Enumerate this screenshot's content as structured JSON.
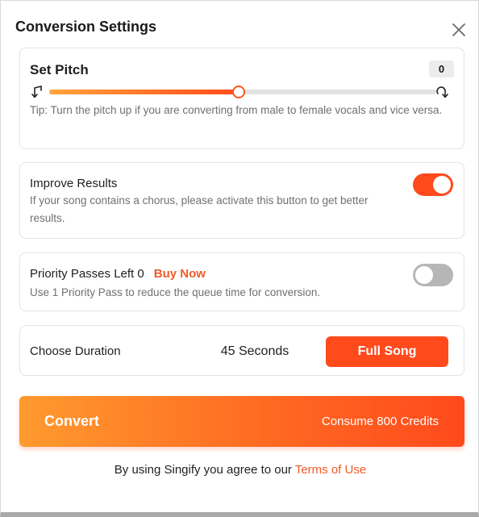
{
  "dialog": {
    "title": "Conversion Settings",
    "close_icon": "close-icon"
  },
  "pitch": {
    "label": "Set Pitch",
    "value": "0",
    "slider_fraction": 0.49,
    "left_icon": "pitch-down-icon",
    "right_icon": "pitch-up-icon",
    "tip": "Tip: Turn the pitch up if you are converting from male to female vocals and vice versa."
  },
  "improve": {
    "label": "Improve Results",
    "description": "If your song contains a chorus, please activate this button to get better results.",
    "enabled": true
  },
  "priority": {
    "label": "Priority Passes Left 0",
    "buy_label": "Buy Now",
    "description": "Use 1 Priority Pass to reduce the queue time for conversion.",
    "enabled": false
  },
  "duration": {
    "label": "Choose Duration",
    "options": [
      "45 Seconds",
      "Full Song"
    ],
    "selected": "Full Song"
  },
  "convert": {
    "label": "Convert",
    "credits": "Consume 800 Credits"
  },
  "footer": {
    "text": "By using Singify you agree to our ",
    "link": "Terms of Use"
  },
  "colors": {
    "accent": "#ff4a1c",
    "accent_light": "#ffa43a",
    "link": "#f05a28",
    "toggle_off": "#b6b6b6"
  }
}
